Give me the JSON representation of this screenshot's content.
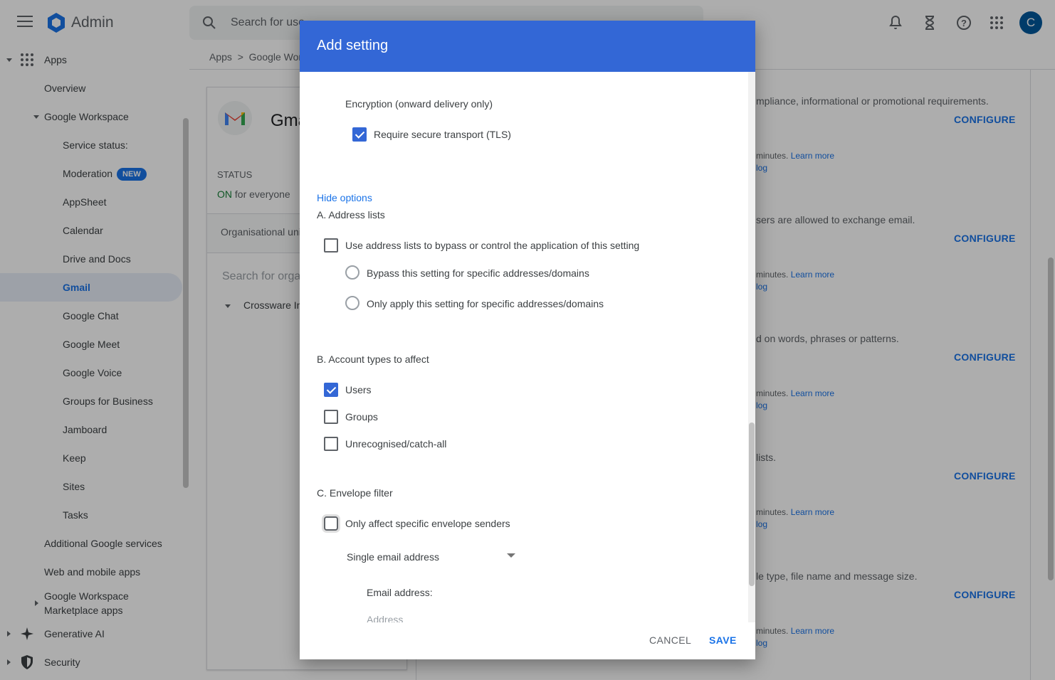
{
  "header": {
    "app_name": "Admin",
    "search_placeholder": "Search for use",
    "avatar_letter": "C"
  },
  "sidebar": {
    "apps": "Apps",
    "overview": "Overview",
    "google_workspace": "Google Workspace",
    "service_status": "Service status:",
    "moderation": "Moderation",
    "new_badge": "NEW",
    "appsheet": "AppSheet",
    "calendar": "Calendar",
    "drive_docs": "Drive and Docs",
    "gmail": "Gmail",
    "google_chat": "Google Chat",
    "google_meet": "Google Meet",
    "google_voice": "Google Voice",
    "groups_business": "Groups for Business",
    "jamboard": "Jamboard",
    "keep": "Keep",
    "sites": "Sites",
    "tasks": "Tasks",
    "additional_services": "Additional Google services",
    "web_mobile": "Web and mobile apps",
    "marketplace_line1": "Google Workspace",
    "marketplace_line2": "Marketplace apps",
    "generative_ai": "Generative AI",
    "security": "Security"
  },
  "main": {
    "breadcrumb": "Apps  >  Google Wor",
    "gmail_title": "Gma",
    "status_label": "STATUS",
    "status_on": "ON",
    "status_rest": " for everyone",
    "org_unit_label": "Organisational uni",
    "org_search_placeholder": "Search for orga",
    "org_node": "Crossware In",
    "right_texts": [
      "mpliance, informational or promotional requirements.",
      "sers are allowed to exchange email.",
      "d on words, phrases or patterns.",
      "lists.",
      "le type, file name and message size."
    ],
    "minutes_text": "minutes. ",
    "learn_more": "Learn more",
    "log_link": "log",
    "configure": "CONFIGURE"
  },
  "dialog": {
    "title": "Add setting",
    "encryption_label": "Encryption (onward delivery only)",
    "require_tls": "Require secure transport (TLS)",
    "require_tls_checked": true,
    "hide_options": "Hide options",
    "section_a": "A. Address lists",
    "use_address_lists": "Use address lists to bypass or control the application of this setting",
    "use_address_lists_checked": false,
    "bypass_option": "Bypass this setting for specific addresses/domains",
    "only_apply_option": "Only apply this setting for specific addresses/domains",
    "section_b": "B. Account types to affect",
    "users": "Users",
    "users_checked": true,
    "groups": "Groups",
    "groups_checked": false,
    "unrecognised": "Unrecognised/catch-all",
    "unrecognised_checked": false,
    "section_c": "C. Envelope filter",
    "envelope_senders": "Only affect specific envelope senders",
    "envelope_senders_checked": false,
    "sender_type_selected": "Single email address",
    "email_address_label": "Email address:",
    "address_placeholder": "Address",
    "cancel": "CANCEL",
    "save": "SAVE"
  },
  "colors": {
    "header_blue": "#3367d6",
    "link_blue": "#1a73e8",
    "status_green": "#188038"
  },
  "icons": [
    "menu-icon",
    "admin-logo-icon",
    "search-icon",
    "bell-icon",
    "hourglass-icon",
    "help-icon",
    "apps-grid-icon",
    "gmail-logo-icon",
    "sparkle-icon",
    "shield-icon"
  ]
}
